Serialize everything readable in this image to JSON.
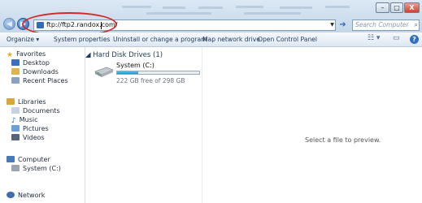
{
  "window": {
    "minimize": "–",
    "maximize": "□",
    "close": "X"
  },
  "nav": {
    "back": "◀",
    "forward": "▶"
  },
  "address": {
    "value": "ftp://ftp2.randox.com/"
  },
  "search": {
    "placeholder": "Search Computer"
  },
  "toolbar": {
    "organize": "Organize ▾",
    "system_properties": "System properties",
    "uninstall": "Uninstall or change a program",
    "map_drive": "Map network drive",
    "control_panel": "Open Control Panel",
    "help": "?"
  },
  "sidebar": {
    "favorites": "Favorites",
    "desktop": "Desktop",
    "downloads": "Downloads",
    "recent": "Recent Places",
    "libraries": "Libraries",
    "documents": "Documents",
    "music": "Music",
    "pictures": "Pictures",
    "videos": "Videos",
    "computer": "Computer",
    "system_c": "System (C:)",
    "network": "Network"
  },
  "content": {
    "group": "Hard Disk Drives (1)",
    "drive_name": "System (C:)",
    "drive_free": "222 GB free of 298 GB",
    "drive_used_fraction": 0.255
  },
  "preview": {
    "message": "Select a file to preview."
  },
  "colors": {
    "highlight_ring": "#d12a2a",
    "accent": "#2e6fc4"
  }
}
